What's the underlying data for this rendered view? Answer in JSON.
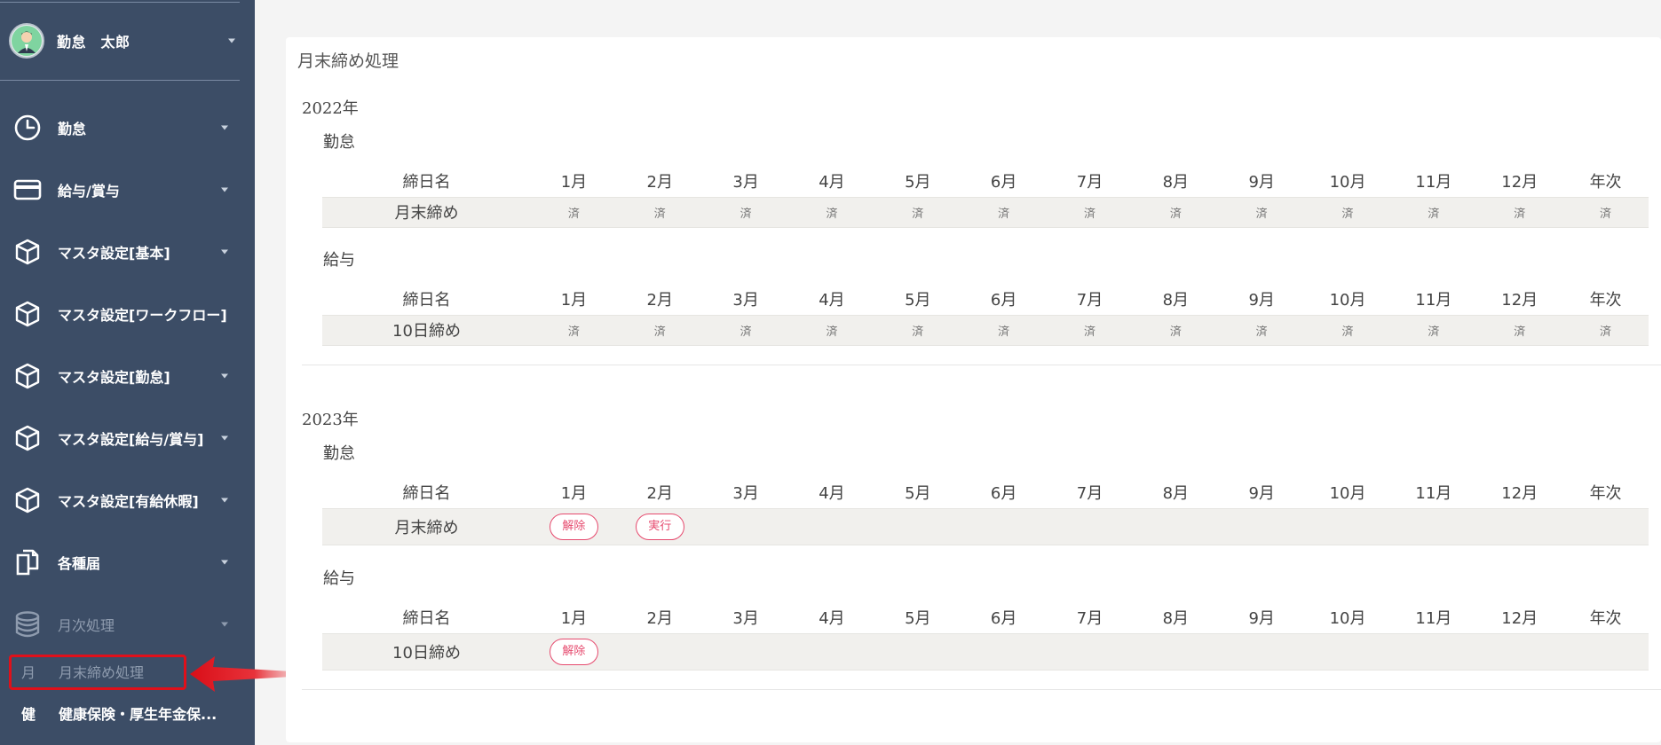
{
  "user": {
    "name": "勤怠　太郎"
  },
  "sidebar": {
    "menu": [
      {
        "label": "勤怠",
        "icon": "clock-icon"
      },
      {
        "label": "給与/賞与",
        "icon": "credit-card-icon"
      },
      {
        "label": "マスタ設定[基本]",
        "icon": "cube-icon"
      },
      {
        "label": "マスタ設定[ワークフロー]",
        "icon": "cube-icon"
      },
      {
        "label": "マスタ設定[勤怠]",
        "icon": "cube-icon"
      },
      {
        "label": "マスタ設定[給与/賞与]",
        "icon": "cube-icon"
      },
      {
        "label": "マスタ設定[有給休暇]",
        "icon": "cube-icon"
      },
      {
        "label": "各種届",
        "icon": "documents-icon"
      },
      {
        "label": "月次処理",
        "icon": "database-icon"
      }
    ],
    "sub_items": [
      {
        "abbr": "月",
        "label": "月末締め処理",
        "active": true
      },
      {
        "abbr": "健",
        "label": "健康保険・厚生年金保..."
      }
    ]
  },
  "main": {
    "title": "月末締め処理",
    "headers": [
      "締日名",
      "1月",
      "2月",
      "3月",
      "4月",
      "5月",
      "6月",
      "7月",
      "8月",
      "9月",
      "10月",
      "11月",
      "12月",
      "年次"
    ],
    "years": [
      {
        "year": "2022年",
        "sections": [
          {
            "label": "勤怠",
            "row_name": "月末締め",
            "cells": [
              "済",
              "済",
              "済",
              "済",
              "済",
              "済",
              "済",
              "済",
              "済",
              "済",
              "済",
              "済",
              "済"
            ]
          },
          {
            "label": "給与",
            "row_name": "10日締め",
            "cells": [
              "済",
              "済",
              "済",
              "済",
              "済",
              "済",
              "済",
              "済",
              "済",
              "済",
              "済",
              "済",
              "済"
            ]
          }
        ]
      },
      {
        "year": "2023年",
        "sections": [
          {
            "label": "勤怠",
            "row_name": "月末締め",
            "cells": [
              "解除",
              "実行",
              "",
              "",
              "",
              "",
              "",
              "",
              "",
              "",
              "",
              "",
              ""
            ]
          },
          {
            "label": "給与",
            "row_name": "10日締め",
            "cells": [
              "解除",
              "",
              "",
              "",
              "",
              "",
              "",
              "",
              "",
              "",
              "",
              "",
              ""
            ]
          }
        ]
      }
    ]
  },
  "colors": {
    "sidebar_bg": "#3c4d66",
    "accent_red": "#e64a6e",
    "annotation_red": "#e0101a",
    "row_bg": "#f1f0ed"
  }
}
